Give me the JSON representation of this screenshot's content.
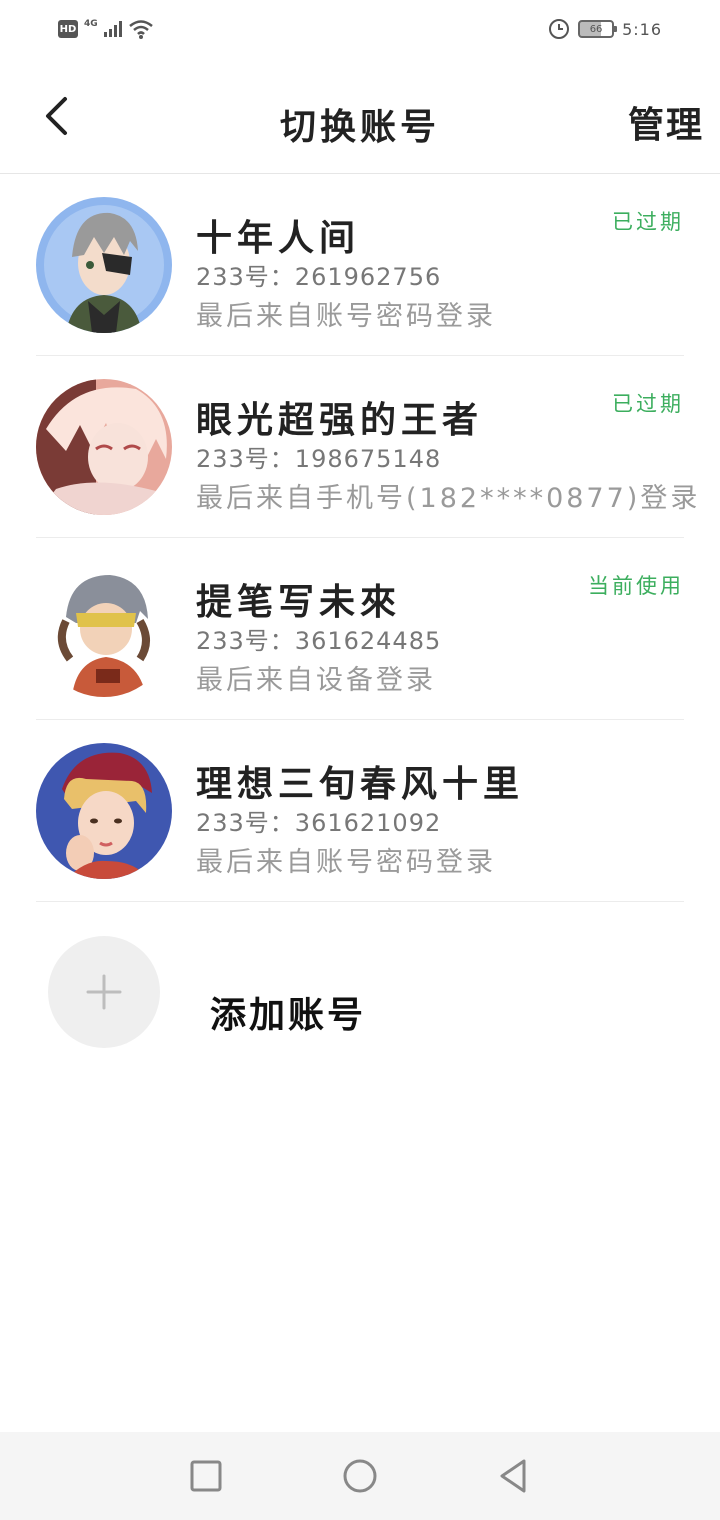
{
  "status_bar": {
    "hd": "HD",
    "network": "4G",
    "battery": "66",
    "time": "5:16"
  },
  "header": {
    "title": "切换账号",
    "manage_label": "管理"
  },
  "accounts": [
    {
      "name": "十年人间",
      "id_text": "233号：261962756",
      "login_text": "最后来自账号密码登录",
      "status": "已过期"
    },
    {
      "name": "眼光超强的王者",
      "id_text": "233号：198675148",
      "login_text": "最后来自手机号(182****0877)登录",
      "status": "已过期"
    },
    {
      "name": "提笔写未來",
      "id_text": "233号：361624485",
      "login_text": "最后来自设备登录",
      "status": "当前使用"
    },
    {
      "name": "理想三旬春风十里",
      "id_text": "233号：361621092",
      "login_text": "最后来自账号密码登录",
      "status": ""
    }
  ],
  "add_account": {
    "label": "添加账号"
  },
  "colors": {
    "status_green": "#3cae5e",
    "divider": "#ececec"
  },
  "icons": {
    "back": "chevron-left-icon",
    "add": "plus-icon",
    "nav_recent": "square-icon",
    "nav_home": "circle-icon",
    "nav_back": "triangle-back-icon"
  }
}
